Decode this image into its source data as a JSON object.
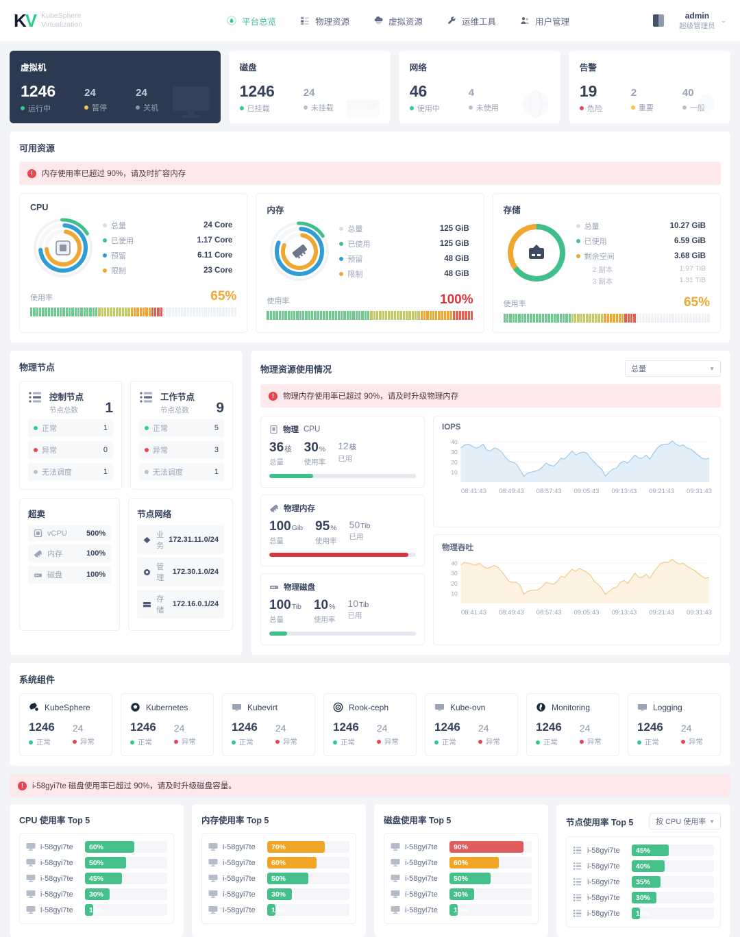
{
  "header": {
    "logo_line1": "KubeSphere",
    "logo_line2": "Virtualization",
    "logo_mark_left": "K",
    "logo_mark_v": "V",
    "nav": [
      {
        "label": "平台总览",
        "icon": "overview-icon",
        "active": true
      },
      {
        "label": "物理资源",
        "icon": "server-icon",
        "active": false
      },
      {
        "label": "虚拟资源",
        "icon": "cloud-icon",
        "active": false
      },
      {
        "label": "运维工具",
        "icon": "wrench-icon",
        "active": false
      },
      {
        "label": "用户管理",
        "icon": "users-icon",
        "active": false
      }
    ],
    "user_name": "admin",
    "user_role": "超级管理员",
    "caret": "⌄"
  },
  "stats": [
    {
      "title": "虚拟机",
      "dark": true,
      "items": [
        {
          "value": "1246",
          "label": "运行中",
          "color": "#2ecc8f"
        },
        {
          "value": "24",
          "label": "暂停",
          "color": "#f5c441"
        },
        {
          "value": "24",
          "label": "关机",
          "color": "#8a94a6"
        }
      ]
    },
    {
      "title": "磁盘",
      "dark": false,
      "items": [
        {
          "value": "1246",
          "label": "已挂载",
          "color": "#2ecc8f"
        },
        {
          "value": "24",
          "label": "未挂载",
          "color": "#b9c0cc"
        }
      ]
    },
    {
      "title": "网络",
      "dark": false,
      "items": [
        {
          "value": "46",
          "label": "使用中",
          "color": "#2ecc8f"
        },
        {
          "value": "4",
          "label": "未使用",
          "color": "#b9c0cc"
        }
      ]
    },
    {
      "title": "告警",
      "dark": false,
      "items": [
        {
          "value": "19",
          "label": "危险",
          "color": "#e8434f"
        },
        {
          "value": "2",
          "label": "重要",
          "color": "#f5c441"
        },
        {
          "value": "40",
          "label": "一般",
          "color": "#b9c0cc"
        }
      ]
    }
  ],
  "available_resources": {
    "title": "可用资源",
    "alert": "内存使用率已超过 90%，请及时扩容内存",
    "alert_icon": "!",
    "cards": [
      {
        "title": "CPU",
        "icon": "cpu-icon",
        "legend": [
          {
            "name": "总量",
            "value": "24 Core",
            "color": "#d8dde5"
          },
          {
            "name": "已使用",
            "value": "1.17 Core",
            "color": "#3fbf8c"
          },
          {
            "name": "预留",
            "value": "6.11 Core",
            "color": "#2f9cd4"
          },
          {
            "name": "限制",
            "value": "23  Core",
            "color": "#f0a732"
          }
        ],
        "sub": [],
        "usage_label": "使用率",
        "usage_pct": "65%",
        "usage_value": 65,
        "usage_color": "#f0a732"
      },
      {
        "title": "内存",
        "icon": "memory-icon",
        "legend": [
          {
            "name": "总量",
            "value": "125 GiB",
            "color": "#d8dde5"
          },
          {
            "name": "已使用",
            "value": "125 GiB",
            "color": "#3fbf8c"
          },
          {
            "name": "预留",
            "value": "48 GiB",
            "color": "#2f9cd4"
          },
          {
            "name": "限制",
            "value": "48  GiB",
            "color": "#f0a732"
          }
        ],
        "sub": [],
        "usage_label": "使用率",
        "usage_pct": "100%",
        "usage_value": 100,
        "usage_color": "#e8434f"
      },
      {
        "title": "存储",
        "icon": "storage-icon",
        "legend": [
          {
            "name": "总量",
            "value": "10.27 GiB",
            "color": "#d8dde5"
          },
          {
            "name": "已使用",
            "value": "6.59 GiB",
            "color": "#3fbf8c"
          },
          {
            "name": "剩余空间",
            "value": "3.68  GiB",
            "color": "#f0a732"
          }
        ],
        "sub": [
          {
            "name": "2 副本",
            "value": "1.97 TiB"
          },
          {
            "name": "3 副本",
            "value": "1.31 TiB"
          }
        ],
        "usage_label": "使用率",
        "usage_pct": "65%",
        "usage_value": 65,
        "usage_color": "#f0a732"
      }
    ]
  },
  "physical_nodes": {
    "title": "物理节点",
    "node_cards": [
      {
        "name": "控制节点",
        "sub_label": "节点总数",
        "total": "1",
        "stats": [
          {
            "label": "正常",
            "value": "1",
            "color": "#2ecc8f"
          },
          {
            "label": "异常",
            "value": "0",
            "color": "#e8434f"
          },
          {
            "label": "无法调度",
            "value": "1",
            "color": "#b9c0cc"
          }
        ]
      },
      {
        "name": "工作节点",
        "sub_label": "节点总数",
        "total": "9",
        "stats": [
          {
            "label": "正常",
            "value": "5",
            "color": "#2ecc8f"
          },
          {
            "label": "异常",
            "value": "3",
            "color": "#e8434f"
          },
          {
            "label": "无法调度",
            "value": "1",
            "color": "#b9c0cc"
          }
        ]
      }
    ],
    "overcommit": {
      "title": "超卖",
      "rows": [
        {
          "icon": "cpu-icon",
          "label": "vCPU",
          "value": "500%"
        },
        {
          "icon": "memory-icon",
          "label": "内存",
          "value": "100%"
        },
        {
          "icon": "disk-icon",
          "label": "磁盘",
          "value": "100%"
        }
      ]
    },
    "node_network": {
      "title": "节点网络",
      "rows": [
        {
          "icon": "business-icon",
          "label": "业务",
          "value": "172.31.11.0/24"
        },
        {
          "icon": "manage-icon",
          "label": "管理",
          "value": "172.30.1.0/24"
        },
        {
          "icon": "storage-icon",
          "label": "存储",
          "value": "172.16.0.1/24"
        }
      ]
    }
  },
  "physical_usage": {
    "title": "物理资源使用情况",
    "select_value": "总量",
    "alert": "物理内存使用率已超过 90%，请及时升级物理内存",
    "alert_icon": "!",
    "boxes": [
      {
        "icon": "cpu-icon",
        "title_prefix": "物理",
        "title_suffix": "CPU",
        "total_value": "36",
        "total_unit": "核",
        "total_label": "总量",
        "pct_value": "30",
        "pct_unit": "%",
        "pct_label": "使用率",
        "used_value": "12",
        "used_unit": "核",
        "used_label": "已用",
        "bar_pct": 30,
        "bar_color": "#3fbf8c"
      },
      {
        "icon": "memory-icon",
        "title_prefix": "物理内存",
        "title_suffix": "",
        "total_value": "100",
        "total_unit": "Gib",
        "total_label": "总量",
        "pct_value": "95",
        "pct_unit": "%",
        "pct_label": "使用率",
        "used_value": "50",
        "used_unit": "Tib",
        "used_label": "已用",
        "bar_pct": 95,
        "bar_color": "#d9353f"
      },
      {
        "icon": "disk-icon",
        "title_prefix": "物理磁盘",
        "title_suffix": "",
        "total_value": "100",
        "total_unit": "Tib",
        "total_label": "总量",
        "pct_value": "10",
        "pct_unit": "%",
        "pct_label": "使用率",
        "used_value": "10",
        "used_unit": "Tib",
        "used_label": "已用",
        "bar_pct": 12,
        "bar_color": "#3fbf8c"
      }
    ]
  },
  "chart_data": [
    {
      "type": "area",
      "title": "IOPS",
      "xlabel": "",
      "ylabel": "",
      "ylim": [
        0,
        45
      ],
      "yticks": [
        10,
        20,
        30,
        40
      ],
      "grid": true,
      "legend": "none",
      "line_color": "#9ec9e8",
      "fill_color": "#d8e9f7",
      "x_ticks": [
        "08:41:43",
        "08:49:43",
        "08:57:43",
        "09:05:43",
        "09:13:43",
        "09:21:43",
        "09:31:43"
      ],
      "values": [
        34,
        37,
        38,
        36,
        34,
        35,
        38,
        32,
        31,
        34,
        33,
        30,
        25,
        21,
        20,
        18,
        12,
        6,
        9,
        10,
        11,
        12,
        15,
        19,
        17,
        16,
        19,
        24,
        23,
        27,
        31,
        27,
        29,
        30,
        29,
        24,
        20,
        16,
        13,
        6,
        10,
        13,
        14,
        19,
        21,
        19,
        23,
        27,
        24,
        24,
        27,
        23,
        29,
        34,
        37,
        38,
        38,
        41,
        38,
        36,
        37,
        34,
        33,
        30,
        27,
        24,
        23,
        24
      ]
    },
    {
      "type": "area",
      "title": "物理吞吐",
      "xlabel": "",
      "ylabel": "",
      "ylim": [
        0,
        45
      ],
      "yticks": [
        10,
        20,
        30,
        40
      ],
      "grid": true,
      "legend": "none",
      "line_color": "#f3c98a",
      "fill_color": "#fdeed8",
      "x_ticks": [
        "08:41:43",
        "08:49:43",
        "08:57:43",
        "09:05:43",
        "09:13:43",
        "09:21:43",
        "09:31:43"
      ],
      "values": [
        38,
        41,
        40,
        39,
        38,
        40,
        37,
        35,
        36,
        38,
        36,
        32,
        27,
        22,
        21,
        21,
        18,
        9,
        12,
        13,
        13,
        14,
        17,
        21,
        20,
        19,
        22,
        27,
        26,
        30,
        34,
        32,
        35,
        33,
        31,
        28,
        22,
        19,
        15,
        9,
        12,
        15,
        16,
        21,
        23,
        20,
        25,
        30,
        26,
        26,
        29,
        25,
        31,
        36,
        40,
        41,
        41,
        44,
        41,
        39,
        40,
        37,
        35,
        33,
        30,
        27,
        25,
        26
      ]
    }
  ],
  "system_components": {
    "title": "系统组件",
    "ok_label": "正常",
    "err_label": "异常",
    "ok_color": "#2ecc8f",
    "err_color": "#e8434f",
    "items": [
      {
        "name": "KubeSphere",
        "icon": "kubesphere-icon",
        "ok": "1246",
        "err": "24"
      },
      {
        "name": "Kubernetes",
        "icon": "kubernetes-icon",
        "ok": "1246",
        "err": "24"
      },
      {
        "name": "Kubevirt",
        "icon": "screen-icon",
        "ok": "1246",
        "err": "24"
      },
      {
        "name": "Rook-ceph",
        "icon": "rook-icon",
        "ok": "1246",
        "err": "24"
      },
      {
        "name": "Kube-ovn",
        "icon": "screen-icon",
        "ok": "1246",
        "err": "24"
      },
      {
        "name": "Monitoring",
        "icon": "monitoring-icon",
        "ok": "1246",
        "err": "24"
      },
      {
        "name": "Logging",
        "icon": "screen-icon",
        "ok": "1246",
        "err": "24"
      }
    ]
  },
  "top5": {
    "alert": "i-58gyi7te 磁盘使用率已超过 90%，请及时升级磁盘容量。",
    "alert_icon": "!",
    "panels": [
      {
        "title": "CPU 使用率 Top 5",
        "icon": "screen-icon",
        "has_select": false,
        "select_value": "",
        "items": [
          {
            "name": "i-58gyi7te",
            "label": "60%",
            "value": 60,
            "color": "#45c08a"
          },
          {
            "name": "i-58gyi7te",
            "label": "50%",
            "value": 50,
            "color": "#45c08a"
          },
          {
            "name": "i-58gyi7te",
            "label": "45%",
            "value": 45,
            "color": "#45c08a"
          },
          {
            "name": "i-58gyi7te",
            "label": "30%",
            "value": 30,
            "color": "#45c08a"
          },
          {
            "name": "i-58gyi7te",
            "label": "10%",
            "value": 10,
            "color": "#45c08a"
          }
        ]
      },
      {
        "title": "内存使用率 Top 5",
        "icon": "screen-icon",
        "has_select": false,
        "select_value": "",
        "items": [
          {
            "name": "i-58gyi7te",
            "label": "70%",
            "value": 70,
            "color": "#f0a526"
          },
          {
            "name": "i-58gyi7te",
            "label": "60%",
            "value": 60,
            "color": "#f0a526"
          },
          {
            "name": "i-58gyi7te",
            "label": "50%",
            "value": 50,
            "color": "#45c08a"
          },
          {
            "name": "i-58gyi7te",
            "label": "30%",
            "value": 30,
            "color": "#45c08a"
          },
          {
            "name": "i-58gyi7te",
            "label": "10%",
            "value": 10,
            "color": "#45c08a"
          }
        ]
      },
      {
        "title": "磁盘使用率 Top 5",
        "icon": "screen-icon",
        "has_select": false,
        "select_value": "",
        "items": [
          {
            "name": "i-58gyi7te",
            "label": "90%",
            "value": 90,
            "color": "#e05b5b"
          },
          {
            "name": "i-58gyi7te",
            "label": "60%",
            "value": 60,
            "color": "#f0a526"
          },
          {
            "name": "i-58gyi7te",
            "label": "50%",
            "value": 50,
            "color": "#45c08a"
          },
          {
            "name": "i-58gyi7te",
            "label": "30%",
            "value": 30,
            "color": "#45c08a"
          },
          {
            "name": "i-58gyi7te",
            "label": "10%",
            "value": 10,
            "color": "#45c08a"
          }
        ]
      },
      {
        "title": "节点使用率 Top 5",
        "icon": "node-icon",
        "has_select": true,
        "select_value": "按 CPU 使用率",
        "items": [
          {
            "name": "i-58gyi7te",
            "label": "45%",
            "value": 45,
            "color": "#45c08a"
          },
          {
            "name": "i-58gyi7te",
            "label": "40%",
            "value": 40,
            "color": "#45c08a"
          },
          {
            "name": "i-58gyi7te",
            "label": "35%",
            "value": 35,
            "color": "#45c08a"
          },
          {
            "name": "i-58gyi7te",
            "label": "30%",
            "value": 30,
            "color": "#45c08a"
          },
          {
            "name": "i-58gyi7te",
            "label": "10%",
            "value": 10,
            "color": "#45c08a"
          }
        ]
      }
    ]
  }
}
